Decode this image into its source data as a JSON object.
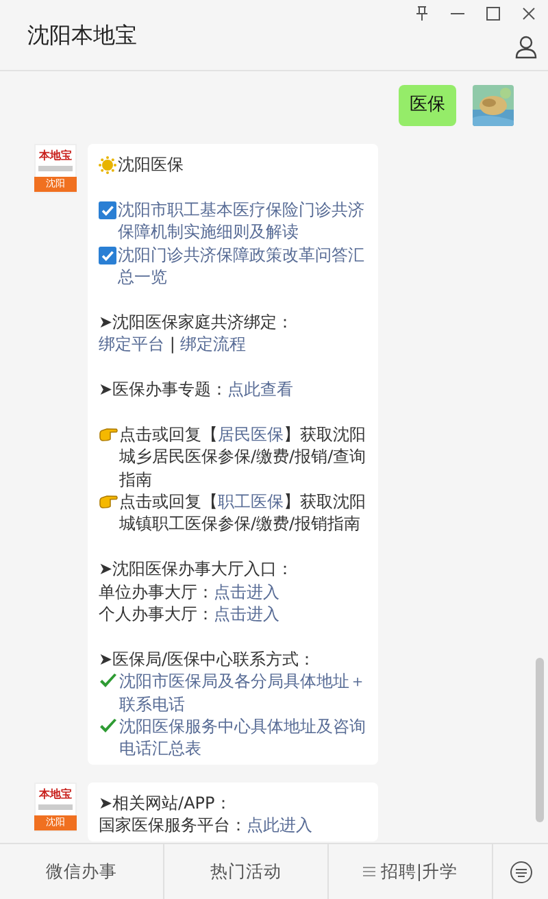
{
  "window": {
    "title": "沈阳本地宝"
  },
  "messages": [
    {
      "kind": "outgoing",
      "text": "医保"
    },
    {
      "kind": "incoming",
      "avatar": {
        "brand": "本地宝",
        "city": "沈阳"
      },
      "paragraphs": [
        [
          {
            "kind": "sun",
            "parts": [
              {
                "text": "沈阳医保",
                "link": false
              }
            ]
          }
        ],
        [
          {
            "kind": "checkbox",
            "parts": [
              {
                "text": "沈阳市职工基本医疗保险门诊共济保障机制实施细则及解读",
                "link": true
              }
            ]
          },
          {
            "kind": "checkbox",
            "parts": [
              {
                "text": "沈阳门诊共济保障政策改革问答汇总一览",
                "link": true
              }
            ]
          }
        ],
        [
          {
            "kind": "plain",
            "parts": [
              {
                "text": "➤沈阳医保家庭共济绑定：",
                "link": false
              }
            ]
          },
          {
            "kind": "plain",
            "parts": [
              {
                "text": "绑定平台",
                "link": true
              },
              {
                "text": " | ",
                "link": false
              },
              {
                "text": "绑定流程",
                "link": true
              }
            ]
          }
        ],
        [
          {
            "kind": "plain",
            "parts": [
              {
                "text": "➤医保办事专题：",
                "link": false
              },
              {
                "text": "点此查看",
                "link": true
              }
            ]
          }
        ],
        [
          {
            "kind": "hand",
            "parts": [
              {
                "text": "点击或回复【",
                "link": false
              },
              {
                "text": "居民医保",
                "link": true
              },
              {
                "text": "】获取沈阳城乡居民医保参保/缴费/报销/查询指南",
                "link": false
              }
            ]
          },
          {
            "kind": "hand",
            "parts": [
              {
                "text": "点击或回复【",
                "link": false
              },
              {
                "text": "职工医保",
                "link": true
              },
              {
                "text": "】获取沈阳城镇职工医保参保/缴费/报销指南",
                "link": false
              }
            ]
          }
        ],
        [
          {
            "kind": "plain",
            "parts": [
              {
                "text": "➤沈阳医保办事大厅入口：",
                "link": false
              }
            ]
          },
          {
            "kind": "plain",
            "parts": [
              {
                "text": "单位办事大厅：",
                "link": false
              },
              {
                "text": "点击进入",
                "link": true
              }
            ]
          },
          {
            "kind": "plain",
            "parts": [
              {
                "text": "个人办事大厅：",
                "link": false
              },
              {
                "text": "点击进入",
                "link": true
              }
            ]
          }
        ],
        [
          {
            "kind": "plain",
            "parts": [
              {
                "text": "➤医保局/医保中心联系方式：",
                "link": false
              }
            ]
          },
          {
            "kind": "check",
            "parts": [
              {
                "text": "沈阳市医保局及各分局具体地址＋联系电话",
                "link": true
              }
            ]
          },
          {
            "kind": "check",
            "parts": [
              {
                "text": "沈阳医保服务中心具体地址及咨询电话汇总表",
                "link": true
              }
            ]
          }
        ]
      ]
    },
    {
      "kind": "incoming",
      "avatar": {
        "brand": "本地宝",
        "city": "沈阳"
      },
      "paragraphs": [
        [
          {
            "kind": "plain",
            "parts": [
              {
                "text": "➤相关网站/APP：",
                "link": false
              }
            ]
          },
          {
            "kind": "plain",
            "parts": [
              {
                "text": "国家医保服务平台：",
                "link": false
              },
              {
                "text": "点此进入",
                "link": true
              }
            ]
          }
        ]
      ]
    }
  ],
  "menu": [
    {
      "kind": "plain",
      "label": "微信办事"
    },
    {
      "kind": "plain",
      "label": "热门活动"
    },
    {
      "kind": "submenu",
      "label": "招聘|升学"
    }
  ]
}
